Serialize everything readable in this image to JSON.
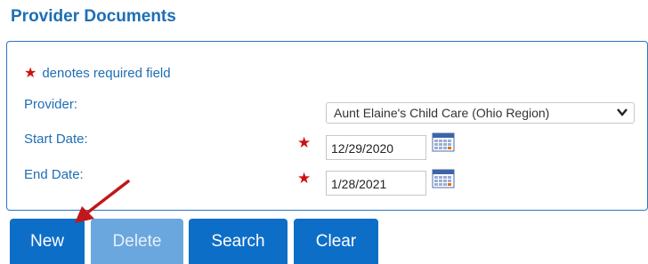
{
  "page": {
    "title": "Provider Documents"
  },
  "form": {
    "required_note": "denotes required field",
    "provider_label": "Provider:",
    "provider_value": "Aunt Elaine's Child Care (Ohio Region)",
    "start_label": "Start Date:",
    "start_value": "12/29/2020",
    "end_label": "End Date:",
    "end_value": "1/28/2021",
    "required_star": "★"
  },
  "buttons": {
    "new": "New",
    "delete": "Delete",
    "search": "Search",
    "clear": "Clear"
  },
  "colors": {
    "primary": "#0d6ec8",
    "disabled": "#6aa7de",
    "heading": "#1e6eb4",
    "required": "#cc1111",
    "annotation_arrow": "#c0181b"
  },
  "icons": {
    "date_picker": "calendar-icon",
    "dropdown": "chevron-down-icon"
  }
}
